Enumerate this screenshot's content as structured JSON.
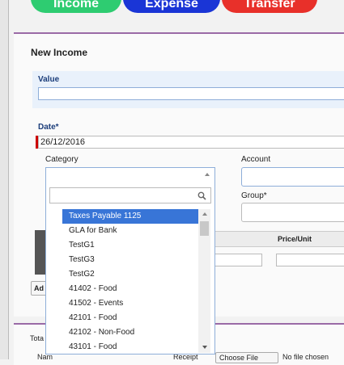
{
  "top_buttons": {
    "income": "Income",
    "expense": "Expense",
    "transfer": "Transfer"
  },
  "colors": {
    "income": "#2ecc71",
    "expense": "#1a35d6",
    "transfer": "#e8302a",
    "accent": "#9a6aa6",
    "selected": "#3875d7"
  },
  "form": {
    "title": "New Income",
    "value_label": "Value",
    "value": "",
    "date_label": "Date*",
    "date_value": "26/12/2016",
    "category_label": "Category",
    "account_label": "Account",
    "group_label": "Group*",
    "price_unit_label": "Price/Unit",
    "add_button": "Ad"
  },
  "category_dropdown": {
    "search_placeholder": "",
    "items": [
      "Taxes Payable 1125",
      "GLA for Bank",
      "TestG1",
      "TestG3",
      "TestG2",
      "41402 - Food",
      "41502 - Events",
      "42101 - Food",
      "42102 - Non-Food",
      "43101 - Food"
    ],
    "selected_index": 0
  },
  "bottom": {
    "total_label": "Tota",
    "name_label": "Nam",
    "receipt_label": "Receipt",
    "choose_file": "Choose File",
    "no_file": "No file chosen"
  }
}
